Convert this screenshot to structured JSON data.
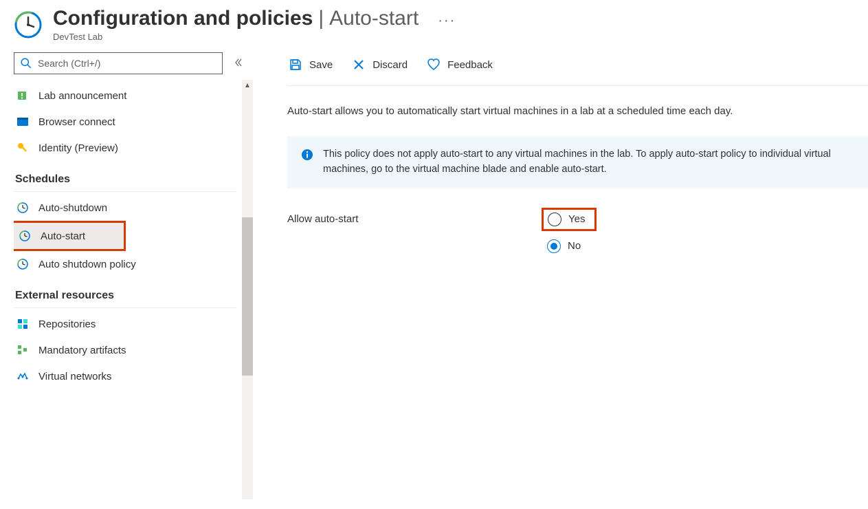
{
  "header": {
    "title": "Configuration and policies",
    "subtitle": "Auto-start",
    "resource_type": "DevTest Lab"
  },
  "search": {
    "placeholder": "Search (Ctrl+/)"
  },
  "sidebar": {
    "items_top": [
      {
        "label": "Lab announcement",
        "icon": "announcement"
      },
      {
        "label": "Browser connect",
        "icon": "browser"
      },
      {
        "label": "Identity (Preview)",
        "icon": "key"
      }
    ],
    "section_schedules": "Schedules",
    "items_schedules": [
      {
        "label": "Auto-shutdown",
        "icon": "clock"
      },
      {
        "label": "Auto-start",
        "icon": "clock"
      },
      {
        "label": "Auto shutdown policy",
        "icon": "clock"
      }
    ],
    "section_external": "External resources",
    "items_external": [
      {
        "label": "Repositories",
        "icon": "repo"
      },
      {
        "label": "Mandatory artifacts",
        "icon": "artifacts"
      },
      {
        "label": "Virtual networks",
        "icon": "network"
      }
    ]
  },
  "toolbar": {
    "save": "Save",
    "discard": "Discard",
    "feedback": "Feedback"
  },
  "content": {
    "description": "Auto-start allows you to automatically start virtual machines in a lab at a scheduled time each day.",
    "info_banner": "This policy does not apply auto-start to any virtual machines in the lab. To apply auto-start policy to individual virtual machines, go to the virtual machine blade and enable auto-start.",
    "form_label": "Allow auto-start",
    "radio_yes": "Yes",
    "radio_no": "No"
  }
}
